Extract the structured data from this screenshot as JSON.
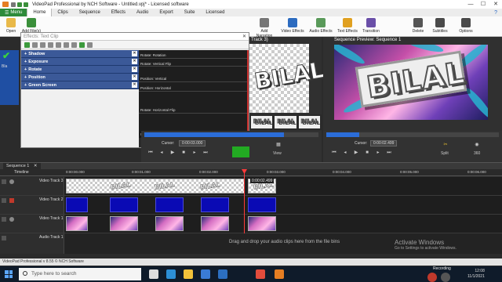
{
  "window": {
    "title": "VideoPad Professional by NCH Software - Untitled.vpj* - Licensed software",
    "buttons": {
      "minimize": "—",
      "maximize": "☐",
      "close": "✕"
    }
  },
  "menu": {
    "menu_label": "Menu",
    "tabs": [
      "Home",
      "Clips",
      "Sequence",
      "Effects",
      "Audio",
      "Export",
      "Suite",
      "Licensed"
    ],
    "active_tab": "Home",
    "help": "?"
  },
  "ribbon": {
    "left": [
      {
        "label": "Open"
      },
      {
        "label": "Add File(s)"
      }
    ],
    "right": [
      {
        "label": "Add Narration",
        "color": "#777777"
      },
      {
        "label": "Video Effects",
        "color": "#2d6cc0"
      },
      {
        "label": "Audio Effects",
        "color": "#5a9a5a"
      },
      {
        "label": "Text Effects",
        "color": "#e0a020"
      },
      {
        "label": "Transition",
        "color": "#6a4fa8"
      },
      {
        "label": "Delete",
        "color": "#555555"
      },
      {
        "label": "Subtitles",
        "color": "#4a4a4a"
      },
      {
        "label": "Options",
        "color": "#4a4a4a"
      }
    ]
  },
  "effects_dialog": {
    "title": "Effects: Text Clip",
    "close": "✕",
    "effects": [
      "Shadow",
      "Exposure",
      "Rotate",
      "Position",
      "Green Screen"
    ],
    "graph_labels": [
      "Rotate: Rotation",
      "Rotate: Vertical Flip",
      "Position: Vertical",
      "Position: Horizontal",
      "Rotate: Horizontal Flip"
    ],
    "time_start": "0:00:00.000",
    "time_end": "0:00:02.000"
  },
  "left_panel": {
    "check": "✔",
    "label": "Bla"
  },
  "clip_preview": {
    "title": "Track 3)",
    "cursor_label": "Cursor:",
    "cursor_value": "0:00:03.000",
    "view_label": "View",
    "scrub_fill": 0.8,
    "thumb_text": "BILAL"
  },
  "sequence_preview": {
    "title": "Sequence Preview: Sequence 1",
    "cursor_label": "Cursor:",
    "cursor_value": "0:00:02.499",
    "split_label": "Split",
    "view360_label": "360",
    "scrub_fill": 0.19,
    "main_text": "BILAL"
  },
  "sequence_tab": {
    "label": "Sequence 1",
    "close": "✕"
  },
  "timeline": {
    "label": "Timeline",
    "ruler": [
      "0:00:00.000",
      "0:00:01.000",
      "0:00:02.000",
      "0:00:03.000",
      "0:00:04.000",
      "0:00:05.000",
      "0:00:06.000"
    ],
    "playhead_time": "0:00:02.499",
    "tracks": [
      {
        "name": "Video Track 3",
        "clip_text": "BILAL"
      },
      {
        "name": "Video Track 2",
        "clip_text": ""
      },
      {
        "name": "Video Track 1",
        "clip_text": "BILAL"
      },
      {
        "name": "Audio Track 1",
        "clip_text": ""
      }
    ],
    "audio_drop_hint": "Drag and drop your audio clips here from the file bins"
  },
  "status_bar": {
    "text": "VideoPad Professional v 8.55 © NCH Software"
  },
  "activation": {
    "line1": "Activate Windows",
    "line2": "Go to Settings to activate Windows."
  },
  "taskbar": {
    "search_placeholder": "Type here to search",
    "apps": [
      {
        "name": "task-view-icon",
        "color": "#dddddd"
      },
      {
        "name": "edge-icon",
        "color": "#2c8fd6"
      },
      {
        "name": "file-explorer-icon",
        "color": "#f2c23a"
      },
      {
        "name": "store-icon",
        "color": "#3a7bd5"
      },
      {
        "name": "mail-icon",
        "color": "#2c6fc0"
      },
      {
        "name": "chrome-icon",
        "color": "#e34c3c"
      },
      {
        "name": "videopad-icon",
        "color": "#e67e22"
      }
    ],
    "recording_label": "Recording",
    "clock_time": "12:08",
    "clock_date": "11/1/2021"
  }
}
